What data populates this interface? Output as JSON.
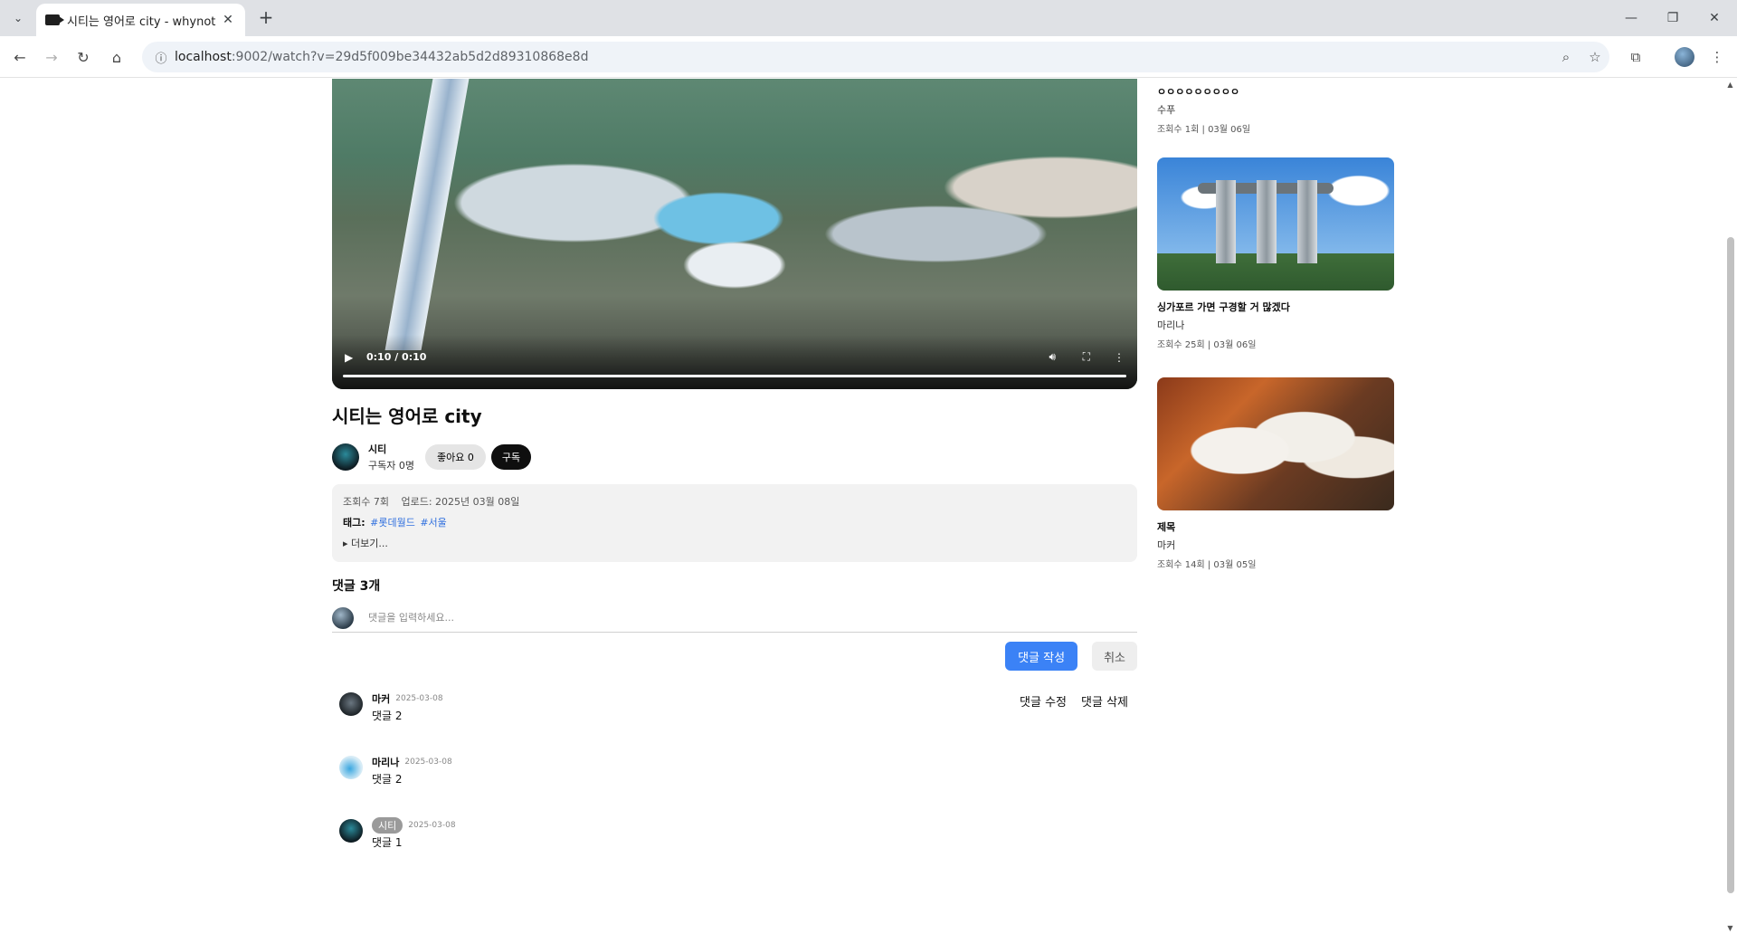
{
  "browser": {
    "tab_title": "시티는 영어로 city - whynot",
    "tab_close": "✕",
    "new_tab": "+",
    "url_host": "localhost",
    "url_rest": ":9002/watch?v=29d5f009be34432ab5d2d89310868e8d"
  },
  "video": {
    "time": "0:10 / 0:10",
    "progress": 1.0
  },
  "title": "시티는 영어로 city",
  "channel": {
    "name": "시티",
    "subscribers": "구독자 0명",
    "like_label": "좋아요 0",
    "subscribe_label": "구독"
  },
  "description": {
    "views": "조회수 7회",
    "upload": "업로드: 2025년 03월 08일",
    "tags_label": "태그:",
    "tags": [
      "#롯데월드",
      "#서울"
    ],
    "more": "▸ 더보기..."
  },
  "comments": {
    "heading": "댓글 3개",
    "placeholder": "댓글을 입력하세요...",
    "post_label": "댓글 작성",
    "cancel_label": "취소",
    "edit_label": "댓글 수정",
    "delete_label": "댓글 삭제",
    "items": [
      {
        "author": "마커",
        "date": "2025-03-08",
        "text": "댓글 2"
      },
      {
        "author": "마리나",
        "date": "2025-03-08",
        "text": "댓글 2"
      },
      {
        "author": "시티",
        "date": "2025-03-08",
        "text": "댓글 1"
      }
    ]
  },
  "sidebar": {
    "items": [
      {
        "title": "ㅇㅇㅇㅇㅇㅇㅇㅇㅇ",
        "channel": "수푸",
        "meta": "조회수 1회 | 03월 06일"
      },
      {
        "title": "싱가포르 가면 구경할 거 많겠다",
        "channel": "마리나",
        "meta": "조회수 25회 | 03월 06일"
      },
      {
        "title": "제목",
        "channel": "마커",
        "meta": "조회수 14회 | 03월 05일"
      }
    ]
  }
}
